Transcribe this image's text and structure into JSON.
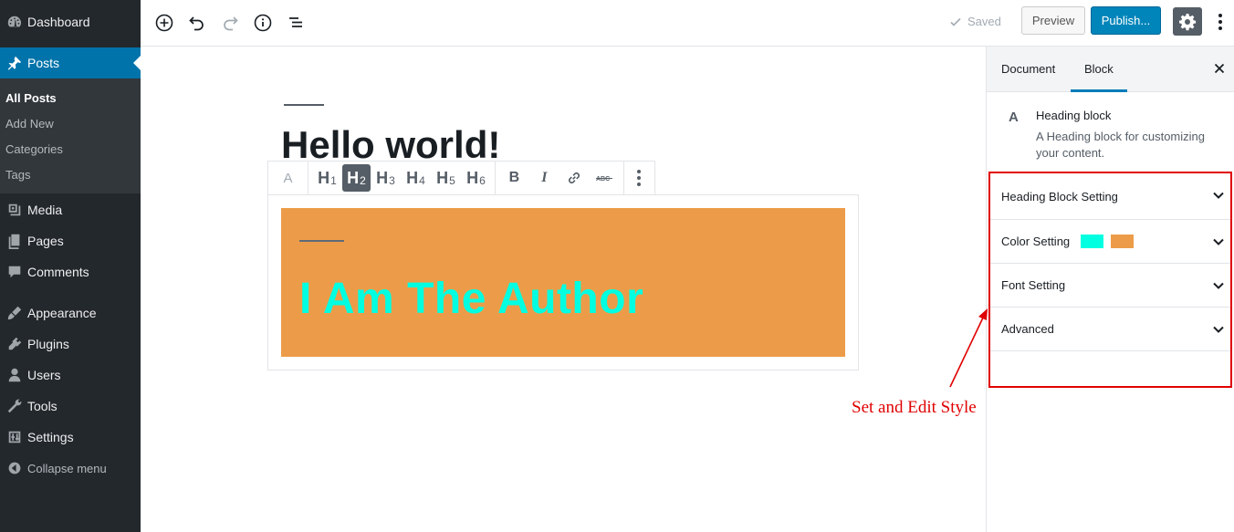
{
  "sidebar": {
    "items": [
      {
        "label": "Dashboard",
        "icon": "dashboard-icon"
      },
      {
        "label": "Posts",
        "icon": "pin-icon",
        "active": true
      },
      {
        "label": "Media",
        "icon": "media-icon"
      },
      {
        "label": "Pages",
        "icon": "pages-icon"
      },
      {
        "label": "Comments",
        "icon": "comments-icon"
      },
      {
        "label": "Appearance",
        "icon": "appearance-icon"
      },
      {
        "label": "Plugins",
        "icon": "plugins-icon"
      },
      {
        "label": "Users",
        "icon": "users-icon"
      },
      {
        "label": "Tools",
        "icon": "tools-icon"
      },
      {
        "label": "Settings",
        "icon": "settings-icon"
      }
    ],
    "submenu": [
      "All Posts",
      "Add New",
      "Categories",
      "Tags"
    ],
    "collapse_label": "Collapse menu"
  },
  "topbar": {
    "saved_label": "Saved",
    "preview_label": "Preview",
    "publish_label": "Publish..."
  },
  "editor": {
    "post_title": "Hello world!",
    "toolbar": {
      "headings": [
        "H1",
        "H2",
        "H3",
        "H4",
        "H5",
        "H6"
      ],
      "active_heading": "H2"
    },
    "heading_block": {
      "text": "I Am The Author",
      "text_color": "#00ffe1",
      "background_color": "#ec9c48"
    }
  },
  "inspector": {
    "tabs": [
      "Document",
      "Block"
    ],
    "active_tab": "Block",
    "block_icon_letter": "A",
    "block_name": "Heading block",
    "block_description": "A Heading block for customizing your content.",
    "panels": [
      {
        "label": "Heading Block Setting"
      },
      {
        "label": "Color Setting",
        "swatches": [
          "#00ffe1",
          "#ec9c48"
        ]
      },
      {
        "label": "Font Setting"
      },
      {
        "label": "Advanced"
      }
    ]
  },
  "annotation": {
    "text": "Set and Edit Style",
    "color": "#e00000"
  }
}
